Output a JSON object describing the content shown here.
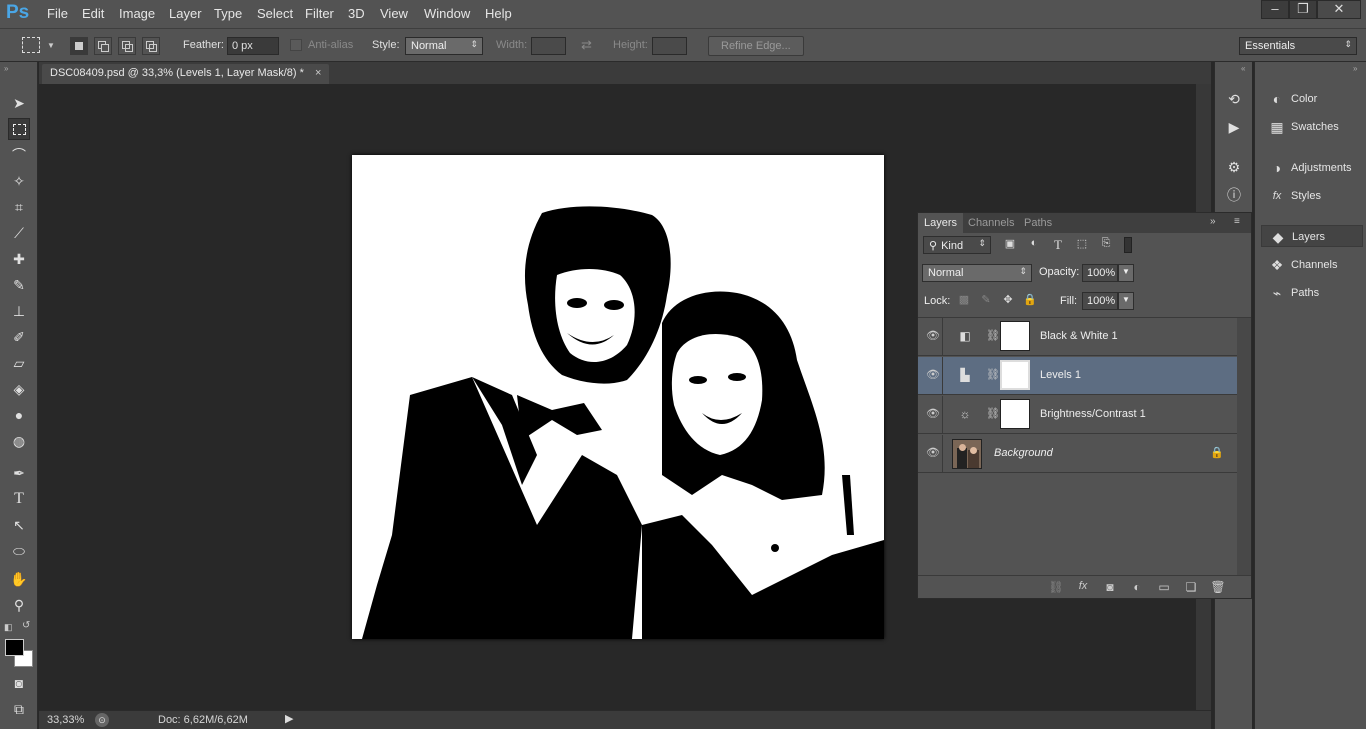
{
  "app": {
    "logo": "Ps"
  },
  "menu": [
    "File",
    "Edit",
    "Image",
    "Layer",
    "Type",
    "Select",
    "Filter",
    "3D",
    "View",
    "Window",
    "Help"
  ],
  "window_controls": {
    "minimize": "‒",
    "restore": "❐",
    "close": "✕"
  },
  "options": {
    "feather_label": "Feather:",
    "feather_value": "0 px",
    "antialias_label": "Anti-alias",
    "style_label": "Style:",
    "style_value": "Normal",
    "width_label": "Width:",
    "height_label": "Height:",
    "refine_label": "Refine Edge...",
    "workspace": "Essentials"
  },
  "document": {
    "tab_title": "DSC08409.psd @ 33,3% (Levels 1, Layer Mask/8) *",
    "close": "×"
  },
  "status": {
    "zoom": "33,33%",
    "doc_info": "Doc: 6,62M/6,62M"
  },
  "dock": {
    "items": [
      {
        "label": "Color",
        "icon": "color-icon"
      },
      {
        "label": "Swatches",
        "icon": "swatches-icon"
      },
      {
        "label": "Adjustments",
        "icon": "adjustments-icon"
      },
      {
        "label": "Styles",
        "icon": "styles-icon"
      },
      {
        "label": "Layers",
        "icon": "layers-icon"
      },
      {
        "label": "Channels",
        "icon": "channels-icon"
      },
      {
        "label": "Paths",
        "icon": "paths-icon"
      }
    ]
  },
  "layers_panel": {
    "tabs": [
      "Layers",
      "Channels",
      "Paths"
    ],
    "filter_kind": "Kind",
    "blend_mode": "Normal",
    "opacity_label": "Opacity:",
    "opacity_value": "100%",
    "lock_label": "Lock:",
    "fill_label": "Fill:",
    "fill_value": "100%",
    "layers": [
      {
        "name": "Black & White 1",
        "type": "black-white-adjustment",
        "selected": false
      },
      {
        "name": "Levels 1",
        "type": "levels-adjustment",
        "selected": true
      },
      {
        "name": "Brightness/Contrast 1",
        "type": "brightness-contrast-adjustment",
        "selected": false
      },
      {
        "name": "Background",
        "type": "image",
        "selected": false,
        "locked": true
      }
    ]
  },
  "colors": {
    "chrome": "#535353",
    "canvas_bg": "#282828",
    "selection": "#5d6d82",
    "logo": "#4aa6e6"
  }
}
